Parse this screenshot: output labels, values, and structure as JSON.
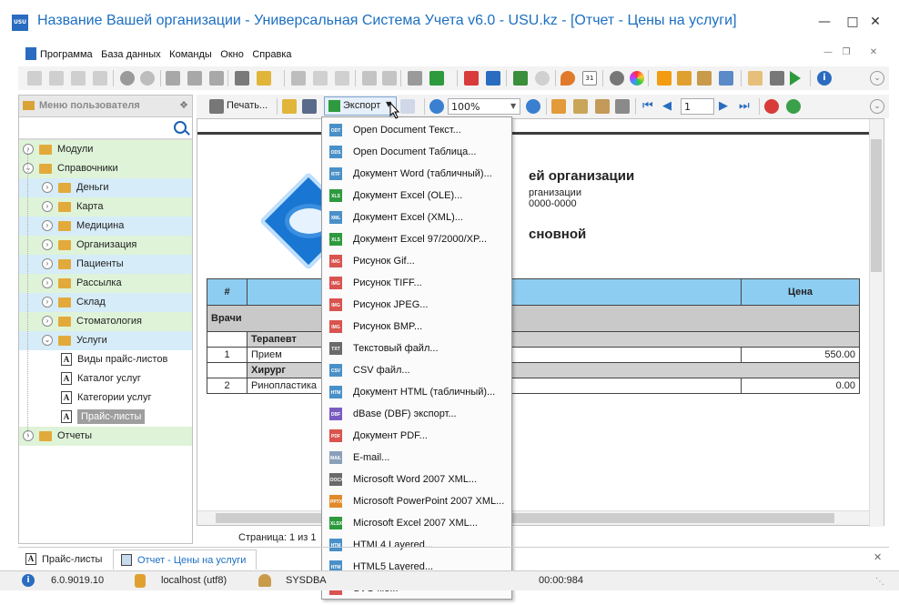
{
  "window": {
    "title": "Название Вашей организации - Универсальная Система Учета v6.0 - USU.kz - [Отчет - Цены на услуги]",
    "app_icon_label": "USU"
  },
  "menu": {
    "items": [
      "Программа",
      "База данных",
      "Команды",
      "Окно",
      "Справка"
    ]
  },
  "report_toolbar": {
    "print_label": "Печать...",
    "export_label": "Экспорт",
    "zoom_value": "100%",
    "page_value": "1"
  },
  "sidebar": {
    "title": "Меню пользователя",
    "tree": [
      {
        "label": "Модули",
        "level": 0,
        "kind": "folder",
        "expander": "right"
      },
      {
        "label": "Справочники",
        "level": 0,
        "kind": "folder",
        "expander": "down"
      },
      {
        "label": "Деньги",
        "level": 1,
        "kind": "folder",
        "expander": "right"
      },
      {
        "label": "Карта",
        "level": 1,
        "kind": "folder",
        "expander": "right"
      },
      {
        "label": "Медицина",
        "level": 1,
        "kind": "folder",
        "expander": "right"
      },
      {
        "label": "Организация",
        "level": 1,
        "kind": "folder",
        "expander": "right"
      },
      {
        "label": "Пациенты",
        "level": 1,
        "kind": "folder",
        "expander": "right"
      },
      {
        "label": "Рассылка",
        "level": 1,
        "kind": "folder",
        "expander": "right"
      },
      {
        "label": "Склад",
        "level": 1,
        "kind": "folder",
        "expander": "right"
      },
      {
        "label": "Стоматология",
        "level": 1,
        "kind": "folder",
        "expander": "right"
      },
      {
        "label": "Услуги",
        "level": 1,
        "kind": "folder",
        "expander": "down"
      },
      {
        "label": "Виды прайс-листов",
        "level": 2,
        "kind": "doc"
      },
      {
        "label": "Каталог услуг",
        "level": 2,
        "kind": "doc"
      },
      {
        "label": "Категории услуг",
        "level": 2,
        "kind": "doc"
      },
      {
        "label": "Прайс-листы",
        "level": 2,
        "kind": "doc",
        "selected": true
      },
      {
        "label": "Отчеты",
        "level": 0,
        "kind": "folder",
        "expander": "right"
      }
    ]
  },
  "report": {
    "org_name_fragment": "ей организации",
    "org_line2": "рганизации",
    "org_line3": "0000-0000",
    "subtitle_fragment": "сновной",
    "table": {
      "headers": [
        "#",
        "",
        "Цена"
      ],
      "group": "Врачи",
      "sections": [
        {
          "name": "Терапевт",
          "rows": [
            {
              "num": "1",
              "name": "Прием",
              "price": "550.00"
            }
          ]
        },
        {
          "name": "Хирург",
          "rows": [
            {
              "num": "2",
              "name": "Ринопластика",
              "price": "0.00"
            }
          ]
        }
      ]
    },
    "page_info": "Страница: 1 из 1"
  },
  "export_menu": {
    "items": [
      {
        "label": "Open Document Текст...",
        "icon": "ODT",
        "color": "#4a90c8"
      },
      {
        "label": "Open Document Таблица...",
        "icon": "ODS",
        "color": "#4a90c8"
      },
      {
        "label": "Документ Word (табличный)...",
        "icon": "RTF",
        "color": "#4a90c8"
      },
      {
        "label": "Документ Excel (OLE)...",
        "icon": "XLS",
        "color": "#2e9a3e"
      },
      {
        "label": "Документ Excel (XML)...",
        "icon": "XML",
        "color": "#4a90c8"
      },
      {
        "label": "Документ Excel 97/2000/XP...",
        "icon": "XLS",
        "color": "#2e9a3e"
      },
      {
        "label": "Рисунок Gif...",
        "icon": "IMG",
        "color": "#d9534f"
      },
      {
        "label": "Рисунок TIFF...",
        "icon": "IMG",
        "color": "#d9534f"
      },
      {
        "label": "Рисунок JPEG...",
        "icon": "IMG",
        "color": "#d9534f"
      },
      {
        "label": "Рисунок BMP...",
        "icon": "IMG",
        "color": "#d9534f"
      },
      {
        "label": "Текстовый файл...",
        "icon": "TXT",
        "color": "#6a6a6a"
      },
      {
        "label": "CSV файл...",
        "icon": "CSV",
        "color": "#4a90c8"
      },
      {
        "label": "Документ HTML (табличный)...",
        "icon": "HTM",
        "color": "#4a90c8"
      },
      {
        "label": "dBase (DBF) экспорт...",
        "icon": "DBF",
        "color": "#7a5cc0"
      },
      {
        "label": "Документ PDF...",
        "icon": "PDF",
        "color": "#d9534f"
      },
      {
        "label": "E-mail...",
        "icon": "MAIL",
        "color": "#8aa0b8"
      },
      {
        "label": "Microsoft Word 2007 XML...",
        "icon": "DOCX",
        "color": "#6a6a6a"
      },
      {
        "label": "Microsoft PowerPoint 2007 XML...",
        "icon": "PPTX",
        "color": "#e08a2a"
      },
      {
        "label": "Microsoft Excel 2007 XML...",
        "icon": "XLSX",
        "color": "#2e9a3e"
      },
      {
        "label": "HTML4 Layered...",
        "icon": "HTM",
        "color": "#4a90c8"
      },
      {
        "label": "HTML5 Layered...",
        "icon": "HTM",
        "color": "#4a90c8"
      },
      {
        "label": "SVG file...",
        "icon": "SVG",
        "color": "#d9534f"
      }
    ]
  },
  "tabs": [
    {
      "label": "Прайс-листы",
      "active": false
    },
    {
      "label": "Отчет - Цены на услуги",
      "active": true
    }
  ],
  "status": {
    "version": "6.0.9019.10",
    "db": "localhost (utf8)",
    "user": "SYSDBA",
    "time": "00:00:984"
  }
}
